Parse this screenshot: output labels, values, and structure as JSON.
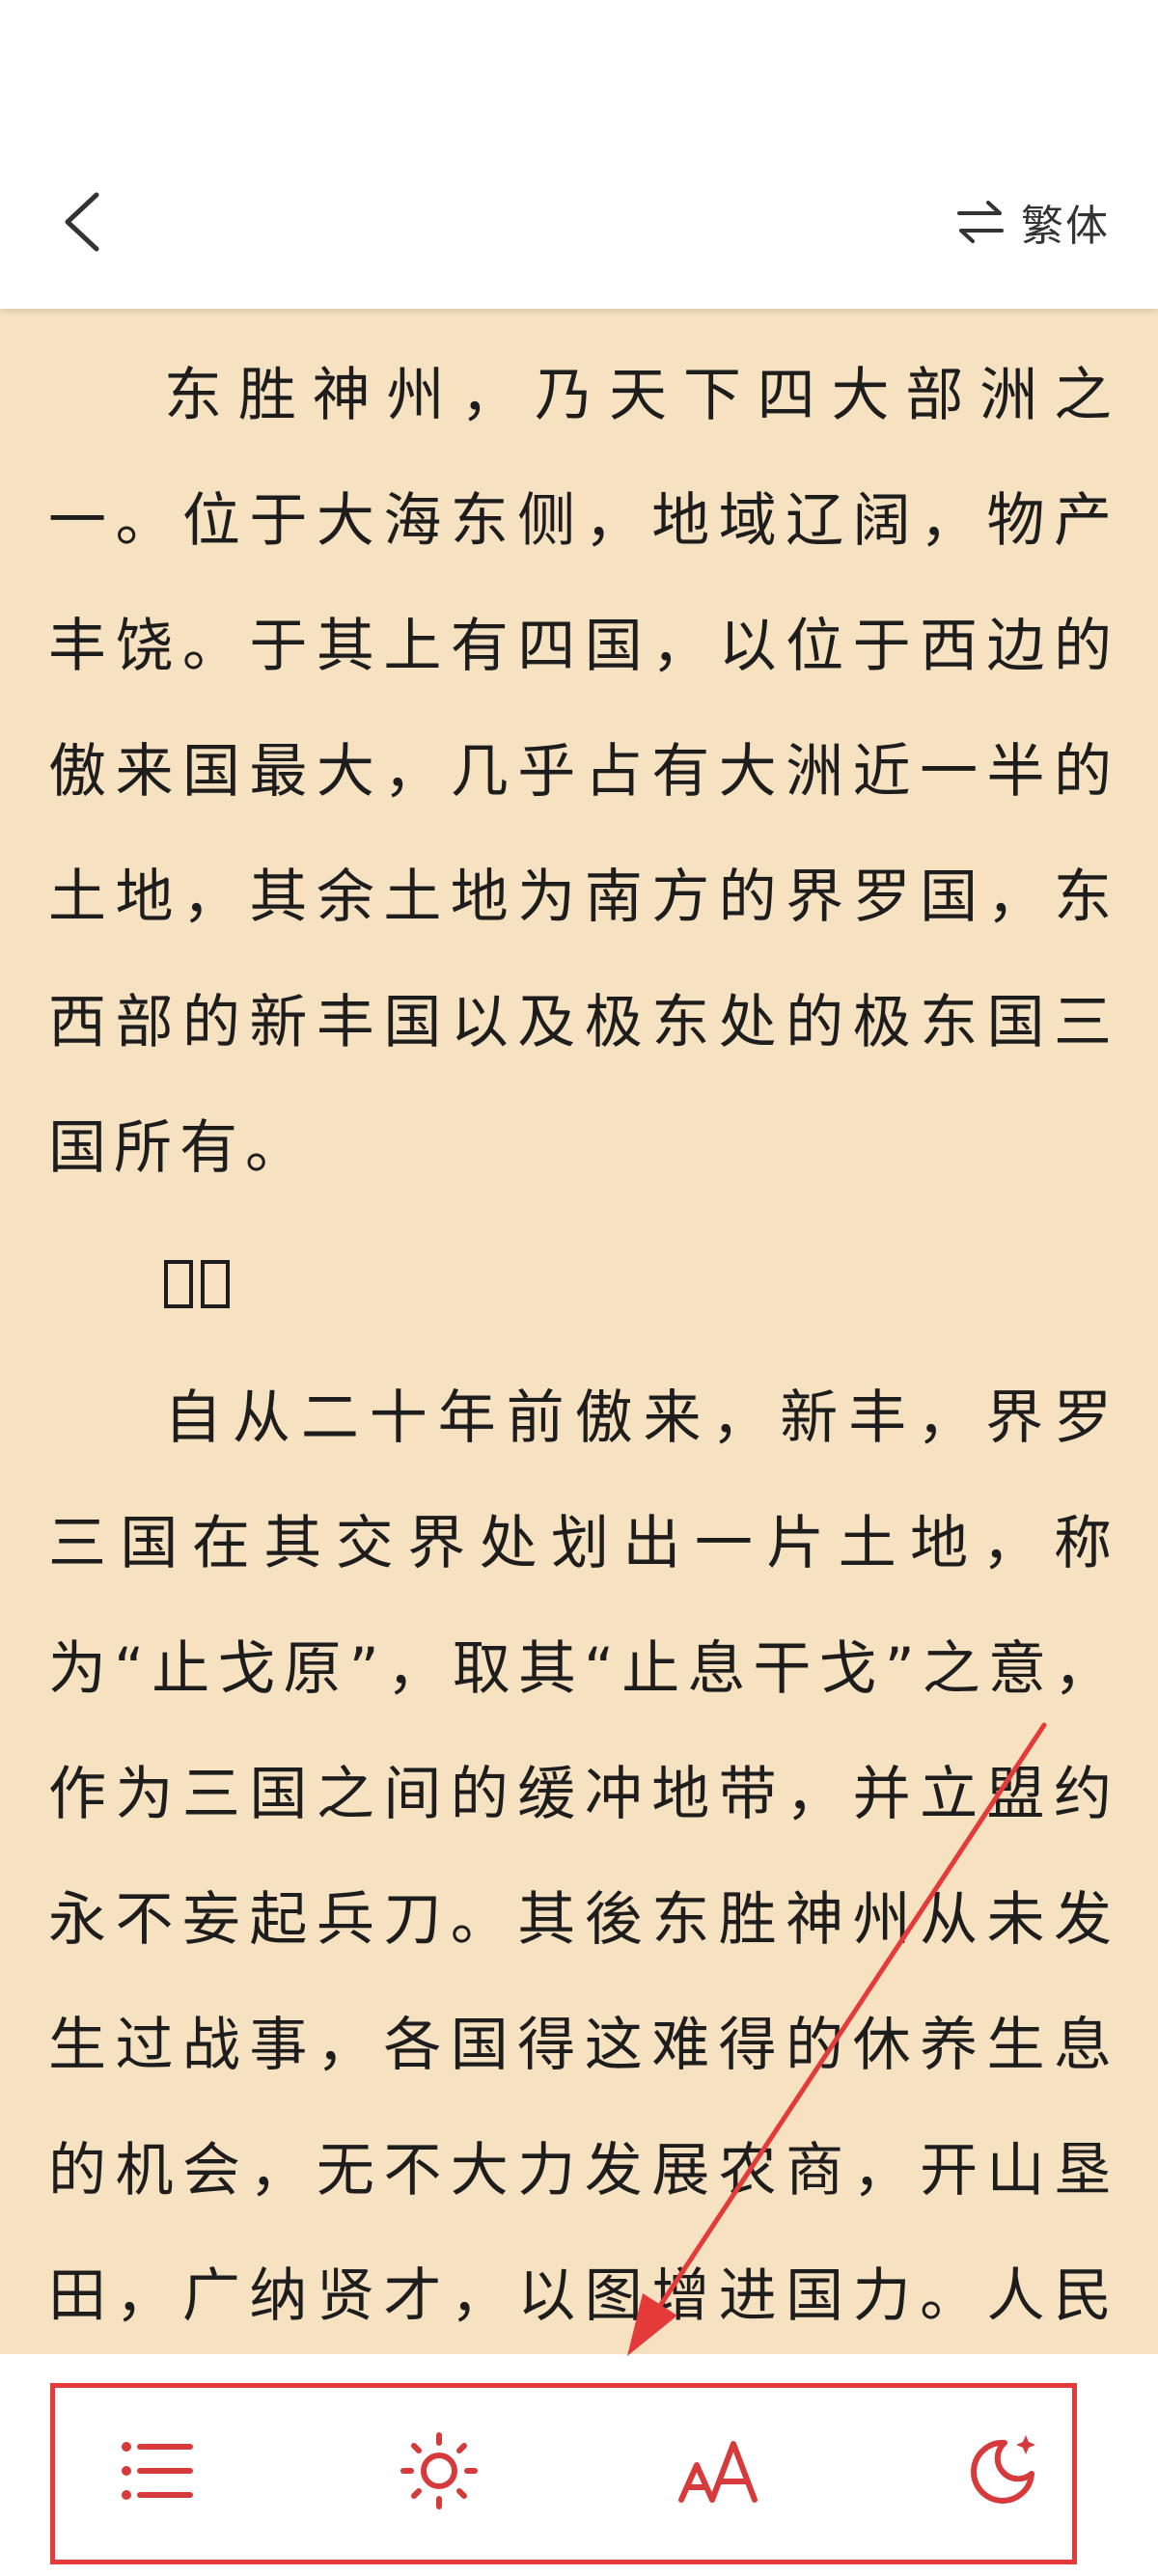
{
  "header": {
    "back_icon": "chevron-left-icon",
    "switch_icon": "swap-arrows-icon",
    "switch_label": "繁体"
  },
  "content": {
    "paragraphs": [
      "东胜神州，乃天下四大部洲之一。位于大海东侧，地域辽阔，物产丰饶。于其上有四国，以位于西边的傲来国最大，几乎占有大洲近一半的土地，其余土地为南方的界罗国，东西部的新丰国以及极东处的极东国三国所有。",
      "",
      "自从二十年前傲来，新丰，界罗三国在其交界处划出一片土地，称为“止戈原”，取其“止息干戈”之意，作为三国之间的缓冲地带，并立盟约永不妄起兵刀。其後东胜神州从未发生过战事，各国得这难得的休养生息的机会，无不大力发展农商，开山垦田，广纳贤才，以图增进国力。人民更"
    ]
  },
  "toolbar": {
    "items": [
      {
        "icon": "catalog-list-icon"
      },
      {
        "icon": "brightness-sun-icon"
      },
      {
        "icon": "font-size-icon"
      },
      {
        "icon": "night-mode-moon-icon"
      }
    ]
  },
  "colors": {
    "page_background": "#f6e1c0",
    "bar_background": "#ffffff",
    "toolbar_icon": "#d73a3a",
    "annotation": "#e53a3a",
    "text": "#1d1d1d"
  }
}
